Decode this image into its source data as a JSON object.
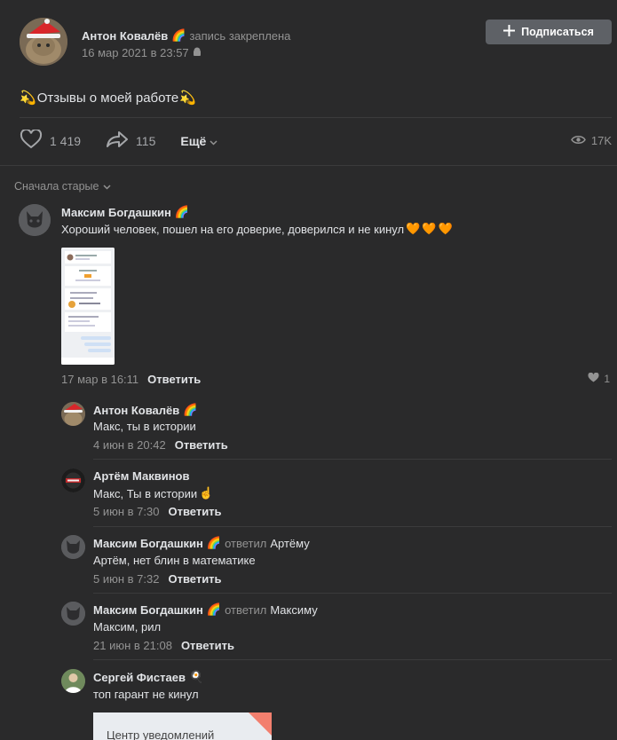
{
  "post": {
    "author": "Антон Ковалёв",
    "pinned_text": "запись закреплена",
    "date": "16 мар 2021 в 23:57",
    "subscribe_label": "Подписаться",
    "text": "Отзывы о моей работе",
    "likes": "1 419",
    "shares": "115",
    "more_label": "Ещё",
    "views": "17K"
  },
  "comments_header": {
    "sort_label": "Сначала старые"
  },
  "comments": [
    {
      "author": "Максим Богдашкин",
      "text": "Хороший человек, пошел на его доверие, доверился и не кинул",
      "date": "17 мар в 16:11",
      "reply_label": "Ответить",
      "likes": "1"
    },
    {
      "author": "Антон Ковалёв",
      "text": "Макс, ты в истории",
      "date": "4 июн в 20:42",
      "reply_label": "Ответить"
    },
    {
      "author": "Артём Маквинов",
      "text": "Макс, Ты в истории",
      "date": "5 июн в 7:30",
      "reply_label": "Ответить"
    },
    {
      "author": "Максим Богдашкин",
      "replied_label": "ответил",
      "replied_to": "Артёму",
      "text": "Артём, нет блин в математике",
      "date": "5 июн в 7:32",
      "reply_label": "Ответить"
    },
    {
      "author": "Максим Богдашкин",
      "replied_label": "ответил",
      "replied_to": "Максиму",
      "text": "Максим, рил",
      "date": "21 июн в 21:08",
      "reply_label": "Ответить"
    },
    {
      "author": "Сергей Фистаев",
      "text": "топ гарант не кинул",
      "attachment_text": "Центр уведомлений"
    }
  ],
  "colors": {
    "background": "#2a2a2b",
    "button": "#5e6166",
    "text": "#e1e3e6",
    "muted": "#939393"
  }
}
